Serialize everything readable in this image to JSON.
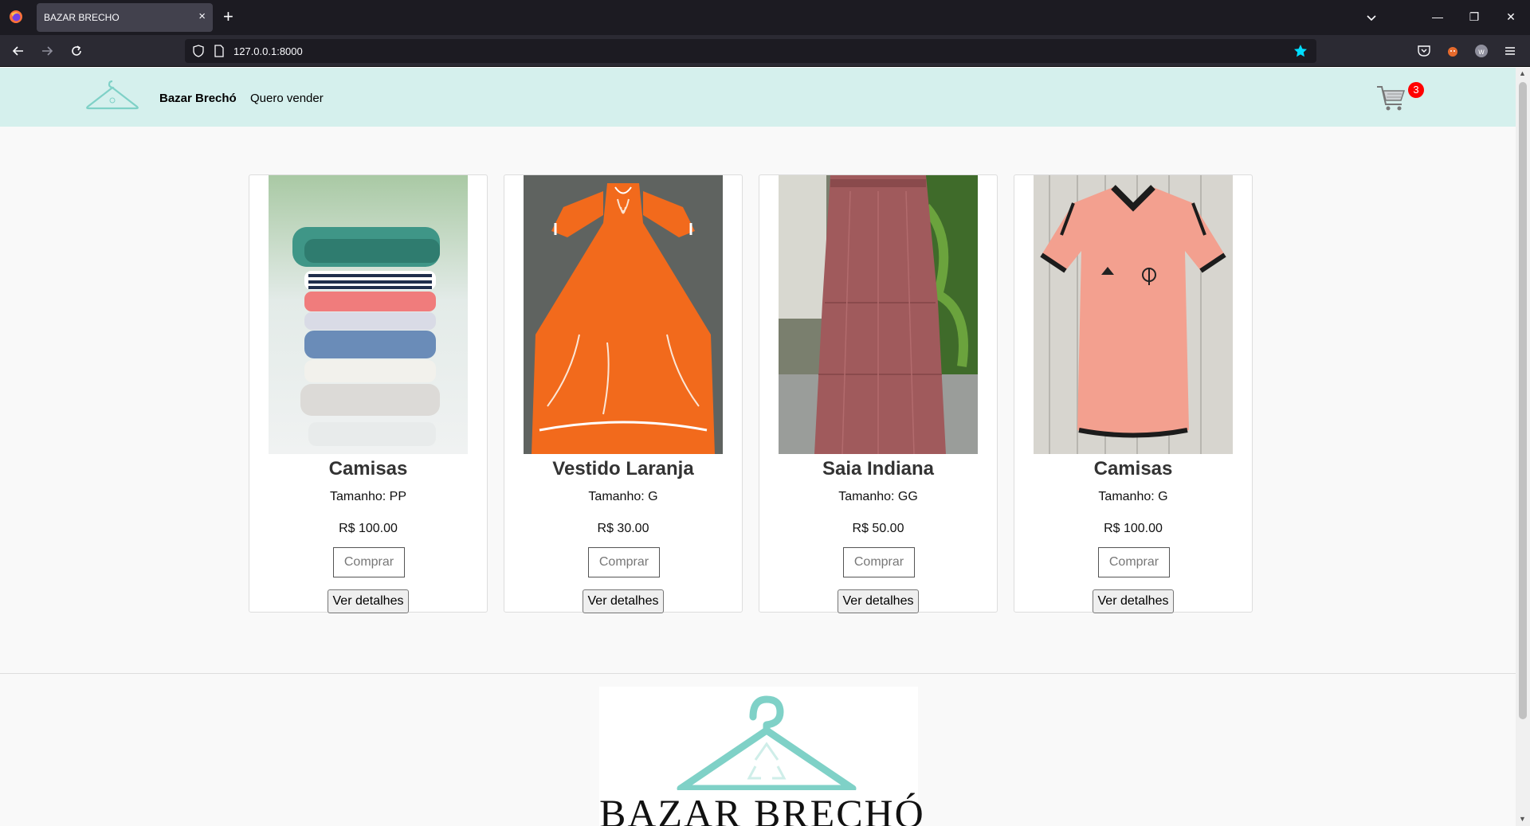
{
  "browser": {
    "tab_title": "BAZAR BRECHO",
    "tab_close": "×",
    "new_tab": "+",
    "url": "127.0.0.1:8000",
    "minimize": "—",
    "restore": "❐",
    "close": "✕"
  },
  "header": {
    "brand": "Bazar Brechó",
    "sell_link": "Quero vender",
    "cart_count": "3",
    "accent_color": "#d5f0ed",
    "logo_color": "#7fd1c7"
  },
  "products": [
    {
      "name": "Camisas",
      "size": "Tamanho: PP",
      "price": "R$ 100.00",
      "buy_label": "Comprar",
      "detail_label": "Ver detalhes",
      "image": "folded-clothes-stack"
    },
    {
      "name": "Vestido Laranja",
      "size": "Tamanho: G",
      "price": "R$ 30.00",
      "buy_label": "Comprar",
      "detail_label": "Ver detalhes",
      "image": "orange-dress"
    },
    {
      "name": "Saia Indiana",
      "size": "Tamanho: GG",
      "price": "R$ 50.00",
      "buy_label": "Comprar",
      "detail_label": "Ver detalhes",
      "image": "mauve-long-skirt"
    },
    {
      "name": "Camisas",
      "size": "Tamanho: G",
      "price": "R$ 100.00",
      "buy_label": "Comprar",
      "detail_label": "Ver detalhes",
      "image": "pink-jersey"
    }
  ],
  "footer": {
    "brand": "BAZAR BRECHÓ"
  }
}
